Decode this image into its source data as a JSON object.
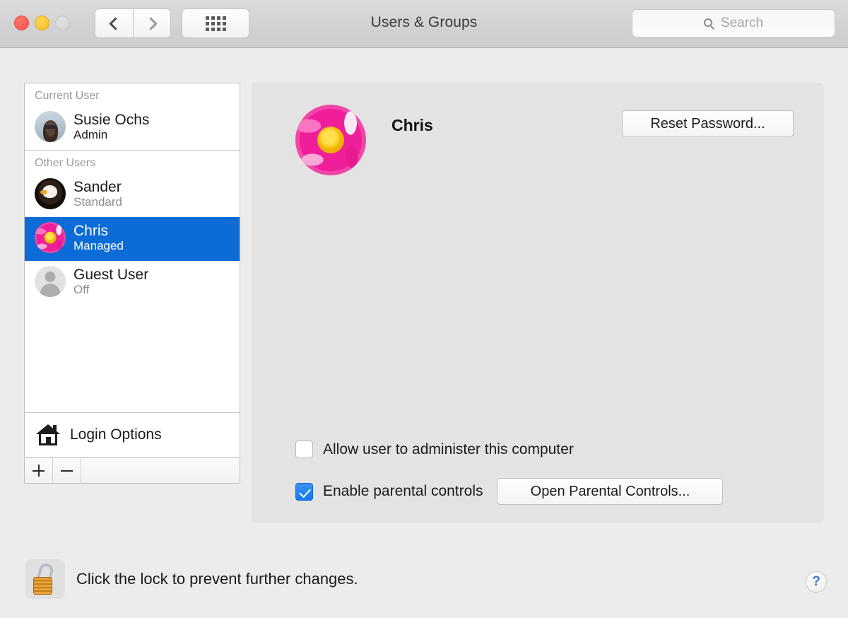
{
  "window": {
    "title": "Users & Groups",
    "traffic_lights": [
      "close",
      "minimize",
      "zoom"
    ],
    "accent_selection_color": "#0b6cd8",
    "checkbox_on_color": "#1479ef"
  },
  "toolbar": {
    "back_label": "Back",
    "forward_label": "Forward",
    "show_all_label": "Show All",
    "search": {
      "placeholder": "Search",
      "value": ""
    }
  },
  "sidebar": {
    "groups": [
      {
        "header": "Current User",
        "users": [
          {
            "name": "Susie Ochs",
            "role": "Admin",
            "avatar": "photo-portrait",
            "selected": false,
            "role_muted": false
          }
        ]
      },
      {
        "header": "Other Users",
        "users": [
          {
            "name": "Sander",
            "role": "Standard",
            "avatar": "photo-eagle",
            "selected": false,
            "role_muted": true
          },
          {
            "name": "Chris",
            "role": "Managed",
            "avatar": "photo-flower",
            "selected": true,
            "role_muted": false
          },
          {
            "name": "Guest User",
            "role": "Off",
            "avatar": "person-silhouette",
            "selected": false,
            "role_muted": true
          }
        ]
      }
    ],
    "login_options_label": "Login Options",
    "add_button_label": "+",
    "remove_button_label": "−"
  },
  "main": {
    "account_name": "Chris",
    "avatar": "photo-flower",
    "reset_password_label": "Reset Password...",
    "options": [
      {
        "label": "Allow user to administer this computer",
        "checked": false
      },
      {
        "label": "Enable parental controls",
        "checked": true
      }
    ],
    "open_parental_controls_label": "Open Parental Controls..."
  },
  "footer": {
    "lock_state": "unlocked",
    "lock_text": "Click the lock to prevent further changes.",
    "help_label": "?"
  }
}
